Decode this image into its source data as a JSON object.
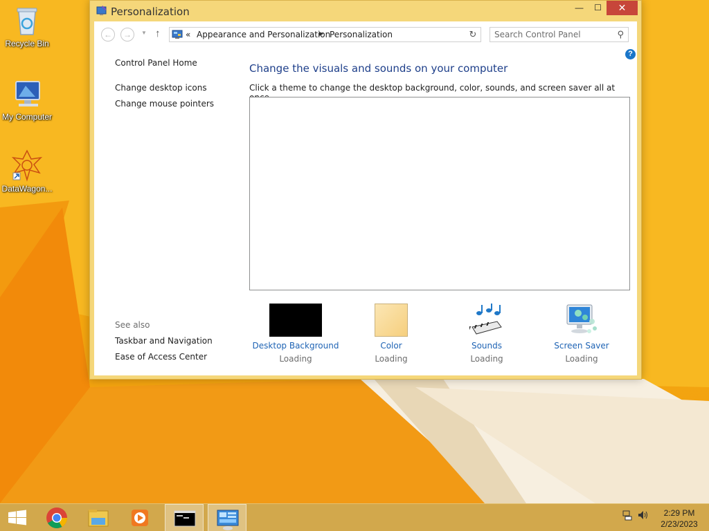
{
  "desktop": {
    "icons": [
      {
        "label": "Recycle Bin"
      },
      {
        "label": "My Computer"
      },
      {
        "label": "DataWagon..."
      }
    ]
  },
  "window": {
    "title": "Personalization",
    "buttons": {
      "minimize": "—",
      "maximize": "☐",
      "close": "✕"
    }
  },
  "address_bar": {
    "overflow": "«",
    "crumbs": [
      "Appearance and Personalization",
      "Personalization"
    ]
  },
  "search": {
    "placeholder": "Search Control Panel"
  },
  "help": "?",
  "sidebar": {
    "home": "Control Panel Home",
    "links": [
      "Change desktop icons",
      "Change mouse pointers"
    ],
    "see_also_heading": "See also",
    "see_also": [
      "Taskbar and Navigation",
      "Ease of Access Center"
    ]
  },
  "main": {
    "heading": "Change the visuals and sounds on your computer",
    "description": "Click a theme to change the desktop background, color, sounds, and screen saver all at once.",
    "options": [
      {
        "label": "Desktop Background",
        "status": "Loading",
        "swatch": "#000000"
      },
      {
        "label": "Color",
        "status": "Loading",
        "swatch": "#f9dc9a"
      },
      {
        "label": "Sounds",
        "status": "Loading"
      },
      {
        "label": "Screen Saver",
        "status": "Loading"
      }
    ]
  },
  "taskbar": {
    "apps": [
      "start-button",
      "chrome",
      "file-explorer",
      "media-player",
      "command-prompt",
      "control-panel"
    ],
    "active": [
      "command-prompt",
      "control-panel"
    ],
    "clock": {
      "time": "2:29 PM",
      "date": "2/23/2023"
    }
  },
  "colors": {
    "accent_link": "#1e63b4",
    "heading": "#1e3f8a",
    "window_frame": "#f5d77a",
    "close_button": "#c7463a"
  }
}
